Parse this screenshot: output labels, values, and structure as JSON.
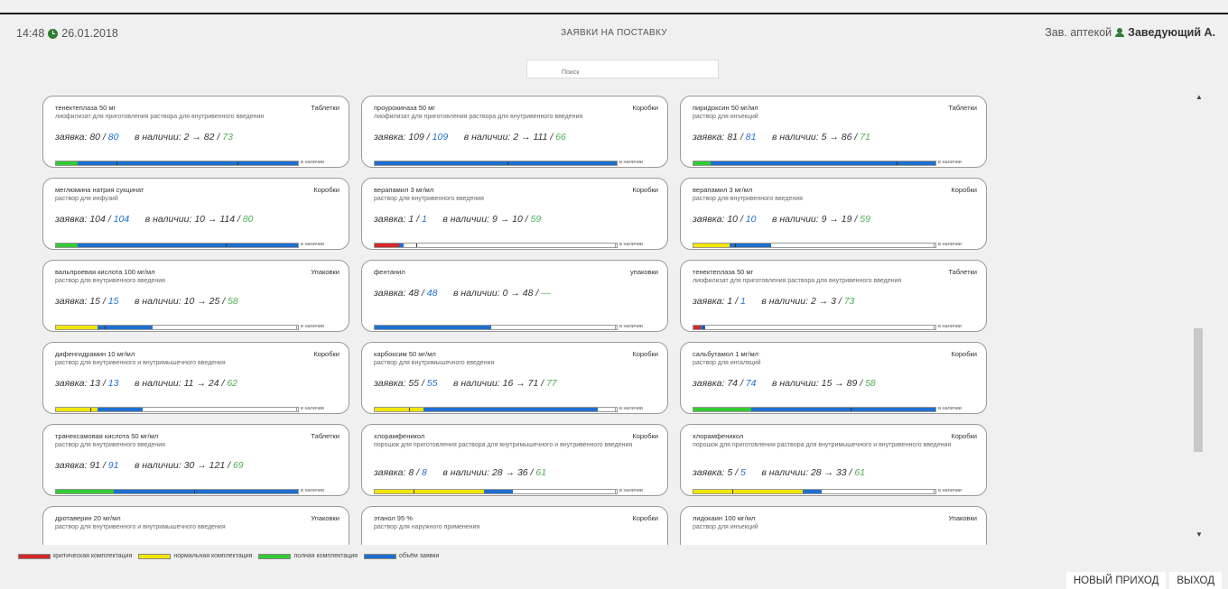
{
  "header": {
    "time": "14:48",
    "date": "26.01.2018",
    "title": "ЗАЯВКИ НА ПОСТАВКУ",
    "role": "Зав. аптекой",
    "user": "Заведующий А."
  },
  "search": {
    "placeholder": "Поиск"
  },
  "labels": {
    "order": "заявка:",
    "stock": "в наличии:",
    "bar_label": "в наличии"
  },
  "colors": {
    "critical": "#d62728",
    "normal": "#f2e600",
    "full": "#33cc33",
    "volume": "#1e6fd0"
  },
  "cards": [
    {
      "name": "тенектеплаза 50 мг",
      "unit": "Таблетки",
      "desc": "лиофилизат для приготовления раствора для внутривенного введения",
      "order_a": "80",
      "order_b": "80",
      "stock_text": "2 → 82",
      "stock_pct": "73",
      "segs": [
        {
          "c": "full",
          "from": 0,
          "to": 0.09
        },
        {
          "c": "volume",
          "from": 0.09,
          "to": 1
        }
      ],
      "ticks": [
        0.25,
        0.75
      ]
    },
    {
      "name": "проурокиназа 50 мг",
      "unit": "Коробки",
      "desc": "лиофилизат для приготовления раствора для внутривенного введения",
      "order_a": "109",
      "order_b": "109",
      "stock_text": "2 → 111",
      "stock_pct": "66",
      "segs": [
        {
          "c": "volume",
          "from": 0,
          "to": 1
        }
      ],
      "ticks": [
        0.55
      ]
    },
    {
      "name": "пиридоксин 50 мг/мл",
      "unit": "Таблетки",
      "desc": "раствор для инъекций",
      "order_a": "81",
      "order_b": "81",
      "stock_text": "5 → 86",
      "stock_pct": "71",
      "segs": [
        {
          "c": "full",
          "from": 0,
          "to": 0.07
        },
        {
          "c": "volume",
          "from": 0.07,
          "to": 1
        }
      ],
      "ticks": [
        0.84
      ]
    },
    {
      "name": "меглюмина натрия сукцинат",
      "unit": "Коробки",
      "desc": "раствор для инфузий",
      "order_a": "104",
      "order_b": "104",
      "stock_text": "10 → 114",
      "stock_pct": "80",
      "segs": [
        {
          "c": "full",
          "from": 0,
          "to": 0.09
        },
        {
          "c": "volume",
          "from": 0.09,
          "to": 1
        }
      ],
      "ticks": [
        0.7
      ]
    },
    {
      "name": "верапамил 3 мг/мл",
      "unit": "Коробки",
      "desc": "раствор для внутривенного введения",
      "order_a": "1",
      "order_b": "1",
      "stock_text": "9 → 10",
      "stock_pct": "59",
      "segs": [
        {
          "c": "critical",
          "from": 0,
          "to": 0.1
        },
        {
          "c": "volume",
          "from": 0.1,
          "to": 0.12
        }
      ],
      "ticks": [
        0.17
      ]
    },
    {
      "name": "верапамил 3 мг/мл",
      "unit": "Коробки",
      "desc": "раствор для внутривенного введения",
      "order_a": "10",
      "order_b": "10",
      "stock_text": "9 → 19",
      "stock_pct": "59",
      "segs": [
        {
          "c": "normal",
          "from": 0,
          "to": 0.15
        },
        {
          "c": "volume",
          "from": 0.15,
          "to": 0.32
        }
      ],
      "ticks": [
        0.17
      ]
    },
    {
      "name": "вальпроевая кислота 100 мг/мл",
      "unit": "Упаковки",
      "desc": "раствор для внутривенного введения",
      "order_a": "15",
      "order_b": "15",
      "stock_text": "10 → 25",
      "stock_pct": "58",
      "segs": [
        {
          "c": "normal",
          "from": 0,
          "to": 0.17
        },
        {
          "c": "volume",
          "from": 0.17,
          "to": 0.4
        }
      ],
      "ticks": [
        0.2
      ]
    },
    {
      "name": "фентанил",
      "unit": "упаковки",
      "desc": "",
      "order_a": "48",
      "order_b": "48",
      "stock_text": "0 → 48",
      "stock_pct": "—",
      "segs": [
        {
          "c": "volume",
          "from": 0,
          "to": 0.48
        }
      ],
      "ticks": []
    },
    {
      "name": "тенектеплаза 50 мг",
      "unit": "Таблетки",
      "desc": "лиофилизат для приготовления раствора для внутривенного введения",
      "order_a": "1",
      "order_b": "1",
      "stock_text": "2 → 3",
      "stock_pct": "73",
      "segs": [
        {
          "c": "critical",
          "from": 0,
          "to": 0.03
        },
        {
          "c": "volume",
          "from": 0.03,
          "to": 0.05
        }
      ],
      "ticks": [
        0.04
      ]
    },
    {
      "name": "дифенгидрамин 10 мг/мл",
      "unit": "Коробки",
      "desc": "раствор для внутривенного и внутримышечного введения",
      "order_a": "13",
      "order_b": "13",
      "stock_text": "11 → 24",
      "stock_pct": "62",
      "segs": [
        {
          "c": "normal",
          "from": 0,
          "to": 0.17
        },
        {
          "c": "volume",
          "from": 0.17,
          "to": 0.36
        }
      ],
      "ticks": [
        0.14
      ]
    },
    {
      "name": "карбоксим 50 мг/мл",
      "unit": "Коробки",
      "desc": "раствор для внутримышечного введения",
      "order_a": "55",
      "order_b": "55",
      "stock_text": "16 → 71",
      "stock_pct": "77",
      "segs": [
        {
          "c": "normal",
          "from": 0,
          "to": 0.2
        },
        {
          "c": "volume",
          "from": 0.2,
          "to": 0.92
        }
      ],
      "ticks": [
        0.14
      ]
    },
    {
      "name": "сальбутамол 1 мг/мл",
      "unit": "Коробки",
      "desc": "раствор для ингаляций",
      "order_a": "74",
      "order_b": "74",
      "stock_text": "15 → 89",
      "stock_pct": "58",
      "segs": [
        {
          "c": "full",
          "from": 0,
          "to": 0.24
        },
        {
          "c": "volume",
          "from": 0.24,
          "to": 1
        }
      ],
      "ticks": [
        0.65
      ]
    },
    {
      "name": "транексамовая кислота 50 мг/мл",
      "unit": "Таблетки",
      "desc": "раствор для внутривенного введения",
      "order_a": "91",
      "order_b": "91",
      "stock_text": "30 → 121",
      "stock_pct": "69",
      "segs": [
        {
          "c": "full",
          "from": 0,
          "to": 0.24
        },
        {
          "c": "volume",
          "from": 0.24,
          "to": 1
        }
      ],
      "ticks": [
        0.57
      ]
    },
    {
      "name": "хлорамфеникол",
      "unit": "Коробки",
      "desc": "порошок для приготовления раствора для внутримышечного и внутривенного введения",
      "order_a": "8",
      "order_b": "8",
      "stock_text": "28 → 36",
      "stock_pct": "61",
      "segs": [
        {
          "c": "normal",
          "from": 0,
          "to": 0.45
        },
        {
          "c": "volume",
          "from": 0.45,
          "to": 0.57
        }
      ],
      "ticks": [
        0.16
      ]
    },
    {
      "name": "хлорамфеникол",
      "unit": "Коробки",
      "desc": "порошок для приготовления раствора для внутримышечного и внутривенного введения",
      "order_a": "5",
      "order_b": "5",
      "stock_text": "28 → 33",
      "stock_pct": "61",
      "segs": [
        {
          "c": "normal",
          "from": 0,
          "to": 0.45
        },
        {
          "c": "volume",
          "from": 0.45,
          "to": 0.53
        }
      ],
      "ticks": [
        0.16
      ]
    },
    {
      "name": "дротаверин 20 мг/мл",
      "unit": "Упаковки",
      "desc": "раствор для внутривенного и внутримышечного введения",
      "order_a": "",
      "order_b": "",
      "stock_text": "",
      "stock_pct": "",
      "segs": [],
      "ticks": []
    },
    {
      "name": "этанол 95 %",
      "unit": "Коробки",
      "desc": "раствор для наружного применения",
      "order_a": "",
      "order_b": "",
      "stock_text": "",
      "stock_pct": "",
      "segs": [],
      "ticks": []
    },
    {
      "name": "лидокаин 100 мг/мл",
      "unit": "Упаковки",
      "desc": "раствор для инъекций",
      "order_a": "",
      "order_b": "",
      "stock_text": "",
      "stock_pct": "",
      "segs": [],
      "ticks": []
    }
  ],
  "legend": [
    {
      "color": "critical",
      "label": "критическая комплектация"
    },
    {
      "color": "normal",
      "label": "нормальная комплектация"
    },
    {
      "color": "full",
      "label": "полная комплектация"
    },
    {
      "color": "volume",
      "label": "объём заявки"
    }
  ],
  "buttons": {
    "new_arrival": "НОВЫЙ ПРИХОД",
    "exit": "ВЫХОД"
  }
}
